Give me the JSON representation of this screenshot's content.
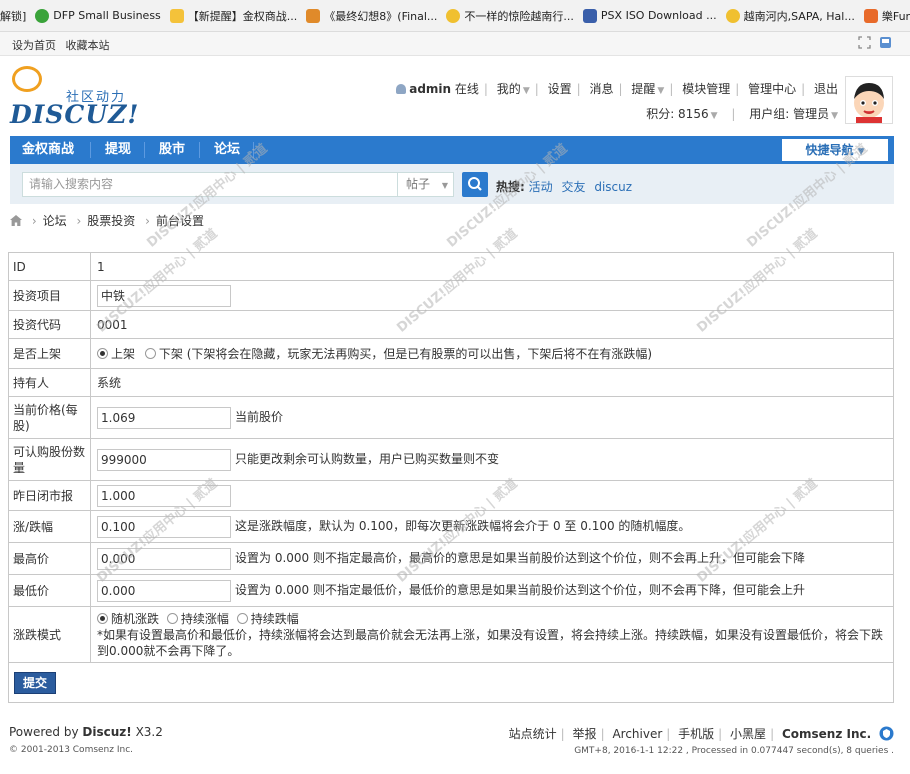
{
  "bookmarks": [
    {
      "label": "解锁]",
      "color": ""
    },
    {
      "label": "DFP Small Business",
      "color": "#3aa33a"
    },
    {
      "label": "【新提醒】金权商战...",
      "color": "#f4c23a"
    },
    {
      "label": "《最终幻想8》(Final...",
      "color": "#e08a2a"
    },
    {
      "label": "不一样的惊险越南行...",
      "color": "#f0c030"
    },
    {
      "label": "PSX ISO Download ...",
      "color": "#3a5faa"
    },
    {
      "label": "越南河内,SAPA, Hal...",
      "color": "#f0c030"
    },
    {
      "label": "樂Fun天",
      "color": "#e86a2a"
    }
  ],
  "topbar": {
    "home": "设为首页",
    "fav": "收藏本站"
  },
  "logo": {
    "tagline": "社区动力",
    "word": "DISCUZ!"
  },
  "user_nav": {
    "username": "admin",
    "online": "在线",
    "items": [
      "我的",
      "设置",
      "消息",
      "提醒",
      "模块管理",
      "管理中心",
      "退出"
    ],
    "points_label": "积分: 8156",
    "group_label": "用户组: 管理员"
  },
  "nav": {
    "items": [
      "金权商战",
      "提现",
      "股市",
      "论坛"
    ],
    "quick": "快捷导航"
  },
  "search": {
    "placeholder": "请输入搜索内容",
    "type": "帖子",
    "hot_label": "热搜:",
    "hot": [
      "活动",
      "交友",
      "discuz"
    ]
  },
  "breadcrumb": [
    "论坛",
    "股票投资",
    "前台设置"
  ],
  "form": {
    "id_label": "ID",
    "id_value": "1",
    "project_label": "投资项目",
    "project_value": "中铁",
    "code_label": "投资代码",
    "code_value": "0001",
    "listed_label": "是否上架",
    "listed_on": "上架",
    "listed_off": "下架",
    "listed_hint": "(下架将会在隐藏，玩家无法再购买，但是已有股票的可以出售，下架后将不在有涨跌幅)",
    "holder_label": "持有人",
    "holder_value": "系统",
    "price_label": "当前价格(每股)",
    "price_value": "1.069",
    "price_hint": "当前股价",
    "shares_label": "可认购股份数量",
    "shares_value": "999000",
    "shares_hint": "只能更改剩余可认购数量，用户已购买数量则不变",
    "close_label": "昨日闭市报",
    "close_value": "1.000",
    "change_label": "涨/跌幅",
    "change_value": "0.100",
    "change_hint": "这是涨跌幅度，默认为 0.100，即每次更新涨跌幅将会介于 0 至 0.100 的随机幅度。",
    "high_label": "最高价",
    "high_value": "0.000",
    "high_hint": "设置为 0.000 则不指定最高价，最高价的意思是如果当前股价达到这个价位，则不会再上升，但可能会下降",
    "low_label": "最低价",
    "low_value": "0.000",
    "low_hint": "设置为 0.000 则不指定最低价，最低价的意思是如果当前股价达到这个价位，则不会再下降，但可能会上升",
    "mode_label": "涨跌模式",
    "mode_options": [
      "随机涨跌",
      "持续涨幅",
      "持续跌幅"
    ],
    "mode_hint": "*如果有设置最高价和最低价，持续涨幅将会达到最高价就会无法再上涨，如果没有设置，将会持续上涨。持续跌幅，如果没有设置最低价，将会下跌到0.000就不会再下降了。",
    "submit": "提交"
  },
  "footer": {
    "powered": "Powered by",
    "brand": "Discuz!",
    "version": "X3.2",
    "copyright": "© 2001-2013 Comsenz Inc.",
    "links": [
      "站点统计",
      "举报",
      "Archiver",
      "手机版",
      "小黑屋"
    ],
    "company": "Comsenz Inc.",
    "gmt": "GMT+8, 2016-1-1 12:22 , Processed in 0.077447 second(s), 8 queries ."
  },
  "watermark": "DISCUZ!应用中心 | 贰道"
}
